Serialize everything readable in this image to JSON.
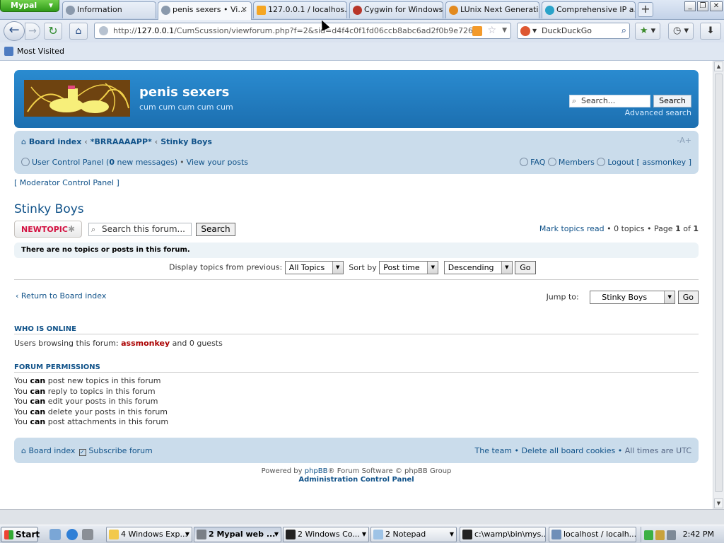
{
  "browser": {
    "app_button": "Mypal",
    "tabs": [
      {
        "label": "Information",
        "favicon": "globe-icon"
      },
      {
        "label": "penis sexers • Vi...",
        "favicon": "globe-icon",
        "active": true
      },
      {
        "label": "127.0.0.1 / localhos...",
        "favicon": "phpmyadmin-icon"
      },
      {
        "label": "Cygwin for Windows...",
        "favicon": "cygwin-icon"
      },
      {
        "label": "LUnix Next Generati...",
        "favicon": "lunix-icon"
      },
      {
        "label": "Comprehensive IP a...",
        "favicon": "location-icon"
      }
    ],
    "url_host": "127.0.0.1",
    "url_prefix": "http://",
    "url_path": "/CumScussion/viewforum.php?f=2&sid=d4f4c0f1fd06ccb8abc6ad2f0b9e726",
    "search_engine": "DuckDuckGo",
    "bookmarks": {
      "most_visited": "Most Visited"
    }
  },
  "forum": {
    "site_name": "penis sexers",
    "site_desc": "cum cum cum cum cum",
    "header_search_placeholder": "Search...",
    "header_search_button": "Search",
    "advanced_search": "Advanced search",
    "breadcrumbs": [
      "Board index",
      "*BRRAAAAPP*",
      "Stinky Boys"
    ],
    "font_size": "-A+",
    "user_cp": "User Control Panel",
    "new_messages_pre": "(",
    "new_messages_count": "0",
    "new_messages_post": "new messages)",
    "view_posts": "View your posts",
    "faq": "FAQ",
    "members": "Members",
    "logout": "Logout [ assmonkey ]",
    "mcp": "[ Moderator Control Panel ]",
    "forum_title": "Stinky Boys",
    "new_topic": "NEWTOPIC",
    "forum_search_placeholder": "Search this forum...",
    "forum_search_button": "Search",
    "mark_read": "Mark topics read",
    "topics_count": "0 topics",
    "page_label": "Page",
    "page_current": "1",
    "page_of": "of",
    "page_total": "1",
    "no_topics": "There are no topics or posts in this forum.",
    "display_label": "Display topics from previous:",
    "display_value": "All Topics",
    "sort_label": "Sort by",
    "sort_value": "Post time",
    "order_value": "Descending",
    "go": "Go",
    "return_link": "Return to Board index",
    "jump_label": "Jump to:",
    "jump_value": "Stinky Boys",
    "who_online_title": "WHO IS ONLINE",
    "browsing_pre": "Users browsing this forum:",
    "browsing_user": "assmonkey",
    "browsing_post": "and 0 guests",
    "permissions_title": "FORUM PERMISSIONS",
    "permissions": [
      {
        "pre": "You",
        "can": "can",
        "rest": "post new topics in this forum"
      },
      {
        "pre": "You",
        "can": "can",
        "rest": "reply to topics in this forum"
      },
      {
        "pre": "You",
        "can": "can",
        "rest": "edit your posts in this forum"
      },
      {
        "pre": "You",
        "can": "can",
        "rest": "delete your posts in this forum"
      },
      {
        "pre": "You",
        "can": "can",
        "rest": "post attachments in this forum"
      }
    ],
    "footer_board_index": "Board index",
    "footer_subscribe": "Subscribe forum",
    "footer_team": "The team",
    "footer_delete_cookies": "Delete all board cookies",
    "footer_timezone": "All times are UTC",
    "powered_pre": "Powered by",
    "powered_link": "phpBB",
    "powered_post": "® Forum Software © phpBB Group",
    "acp": "Administration Control Panel"
  },
  "taskbar": {
    "start": "Start",
    "tasks": [
      {
        "label": "4 Windows Exp...",
        "icon": "folder-icon"
      },
      {
        "label": "2 Mypal web ...",
        "icon": "mypal-icon",
        "active": true
      },
      {
        "label": "2 Windows Co...",
        "icon": "console-icon"
      },
      {
        "label": "2 Notepad",
        "icon": "notepad-icon"
      },
      {
        "label": "c:\\wamp\\bin\\mys...",
        "icon": "console-icon"
      },
      {
        "label": "localhost / localh...",
        "icon": "browser-icon"
      }
    ],
    "clock": "2:42 PM"
  },
  "colors": {
    "header_blue": "#1c6fb0",
    "nav_box": "#cadceb",
    "link": "#105289",
    "new_topic_red": "#d31141",
    "user_red": "#aa0000"
  }
}
